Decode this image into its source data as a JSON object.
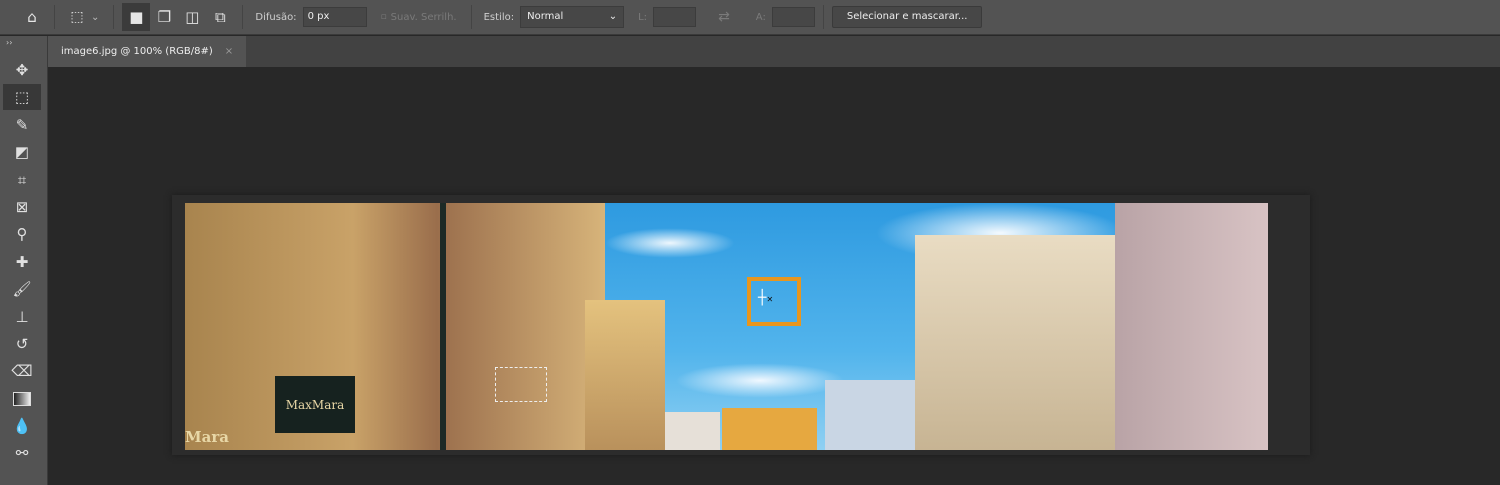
{
  "options_bar": {
    "home_icon": "home-icon",
    "feather_label": "Difusão:",
    "feather_value": "0 px",
    "antialias_label": "Suav. Serrilh.",
    "style_label": "Estilo:",
    "style_value": "Normal",
    "width_label": "L:",
    "height_label": "A:",
    "select_mask_button": "Selecionar e mascarar..."
  },
  "document_tab": {
    "title": "image6.jpg @ 100% (RGB/8#)",
    "close": "×"
  },
  "panel_toggle": "››",
  "tools": [
    "move",
    "rectangular-marquee",
    "quick-selection",
    "object-selection",
    "crop",
    "frame",
    "eyedropper",
    "healing-brush",
    "brush",
    "clone-stamp",
    "history-brush",
    "eraser",
    "gradient",
    "blur",
    "dodge"
  ],
  "photo_signs": [
    "MaxMara",
    "Mara"
  ],
  "colors": {
    "accent": "#e8961e",
    "chrome": "#535353",
    "canvas": "#282828"
  }
}
